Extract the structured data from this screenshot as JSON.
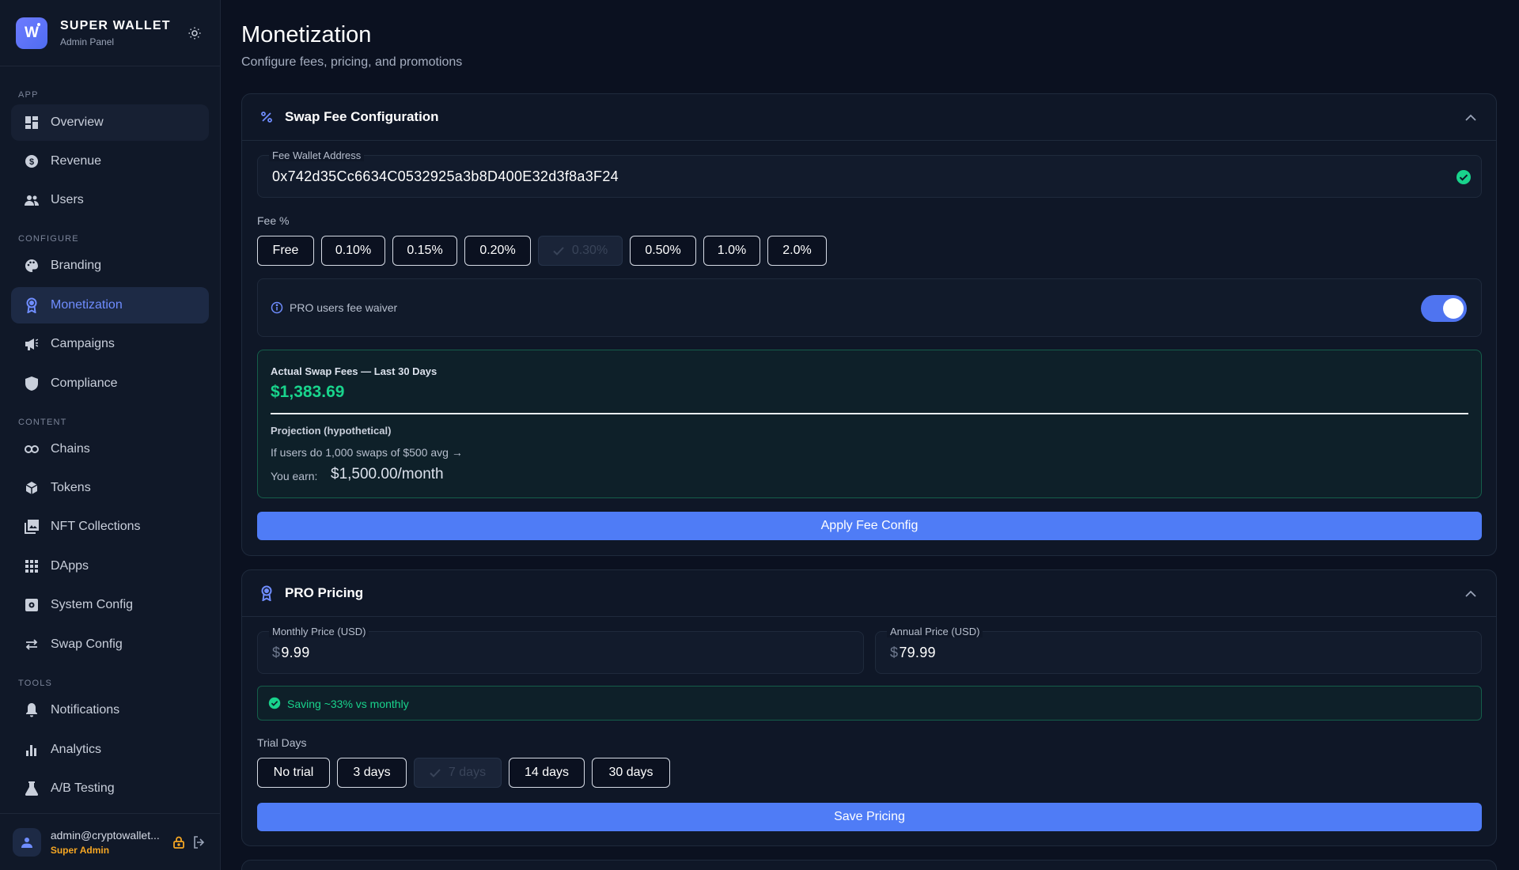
{
  "brand": {
    "logo_letter": "W",
    "name": "SUPER WALLET",
    "subtitle": "Admin Panel"
  },
  "sidebar": {
    "sections": [
      {
        "title": "APP"
      },
      {
        "title": "CONFIGURE"
      },
      {
        "title": "CONTENT"
      },
      {
        "title": "TOOLS"
      }
    ],
    "items": [
      {
        "label": "Overview",
        "icon": "dashboard-icon"
      },
      {
        "label": "Revenue",
        "icon": "dollar-icon"
      },
      {
        "label": "Users",
        "icon": "users-icon"
      },
      {
        "label": "Branding",
        "icon": "palette-icon"
      },
      {
        "label": "Monetization",
        "icon": "award-icon",
        "active": true
      },
      {
        "label": "Campaigns",
        "icon": "megaphone-icon"
      },
      {
        "label": "Compliance",
        "icon": "shield-icon"
      },
      {
        "label": "Chains",
        "icon": "link-icon"
      },
      {
        "label": "Tokens",
        "icon": "cube-icon"
      },
      {
        "label": "NFT Collections",
        "icon": "image-icon"
      },
      {
        "label": "DApps",
        "icon": "apps-icon"
      },
      {
        "label": "System Config",
        "icon": "settings-icon"
      },
      {
        "label": "Swap Config",
        "icon": "swap-icon"
      },
      {
        "label": "Notifications",
        "icon": "bell-icon"
      },
      {
        "label": "Analytics",
        "icon": "bar-chart-icon"
      },
      {
        "label": "A/B Testing",
        "icon": "flask-icon"
      }
    ],
    "user": {
      "email": "admin@cryptowallet...",
      "role": "Super Admin"
    }
  },
  "page": {
    "title": "Monetization",
    "subtitle": "Configure fees, pricing, and promotions"
  },
  "swap_fee": {
    "title": "Swap Fee Configuration",
    "wallet_label": "Fee Wallet Address",
    "wallet_value": "0x742d35Cc6634C0532925a3b8D400E32d3f8a3F24",
    "fee_label": "Fee %",
    "fee_options": [
      "Free",
      "0.10%",
      "0.15%",
      "0.20%",
      "0.30%",
      "0.50%",
      "1.0%",
      "2.0%"
    ],
    "selected_fee": "0.30%",
    "waiver_label": "PRO users fee waiver",
    "waiver_enabled": true,
    "actual_label": "Actual Swap Fees — Last 30 Days",
    "actual_value": "$1,383.69",
    "projection_title": "Projection (hypothetical)",
    "projection_text": "If users do 1,000 swaps of $500 avg →",
    "earn_label": "You earn:",
    "earn_value": "$1,500.00/month",
    "apply_label": "Apply Fee Config"
  },
  "pro_pricing": {
    "title": "PRO Pricing",
    "monthly_label": "Monthly Price (USD)",
    "monthly_currency": "$",
    "monthly_value": "9.99",
    "annual_label": "Annual Price (USD)",
    "annual_currency": "$",
    "annual_value": "79.99",
    "saving_text": "Saving ~33% vs monthly",
    "trial_label": "Trial Days",
    "trial_options": [
      "No trial",
      "3 days",
      "7 days",
      "14 days",
      "30 days"
    ],
    "selected_trial": "7 days",
    "save_label": "Save Pricing"
  },
  "colors": {
    "accent": "#4f7cf6",
    "success": "#19d38c",
    "warning": "#f5a623",
    "background": "#0b1120"
  }
}
